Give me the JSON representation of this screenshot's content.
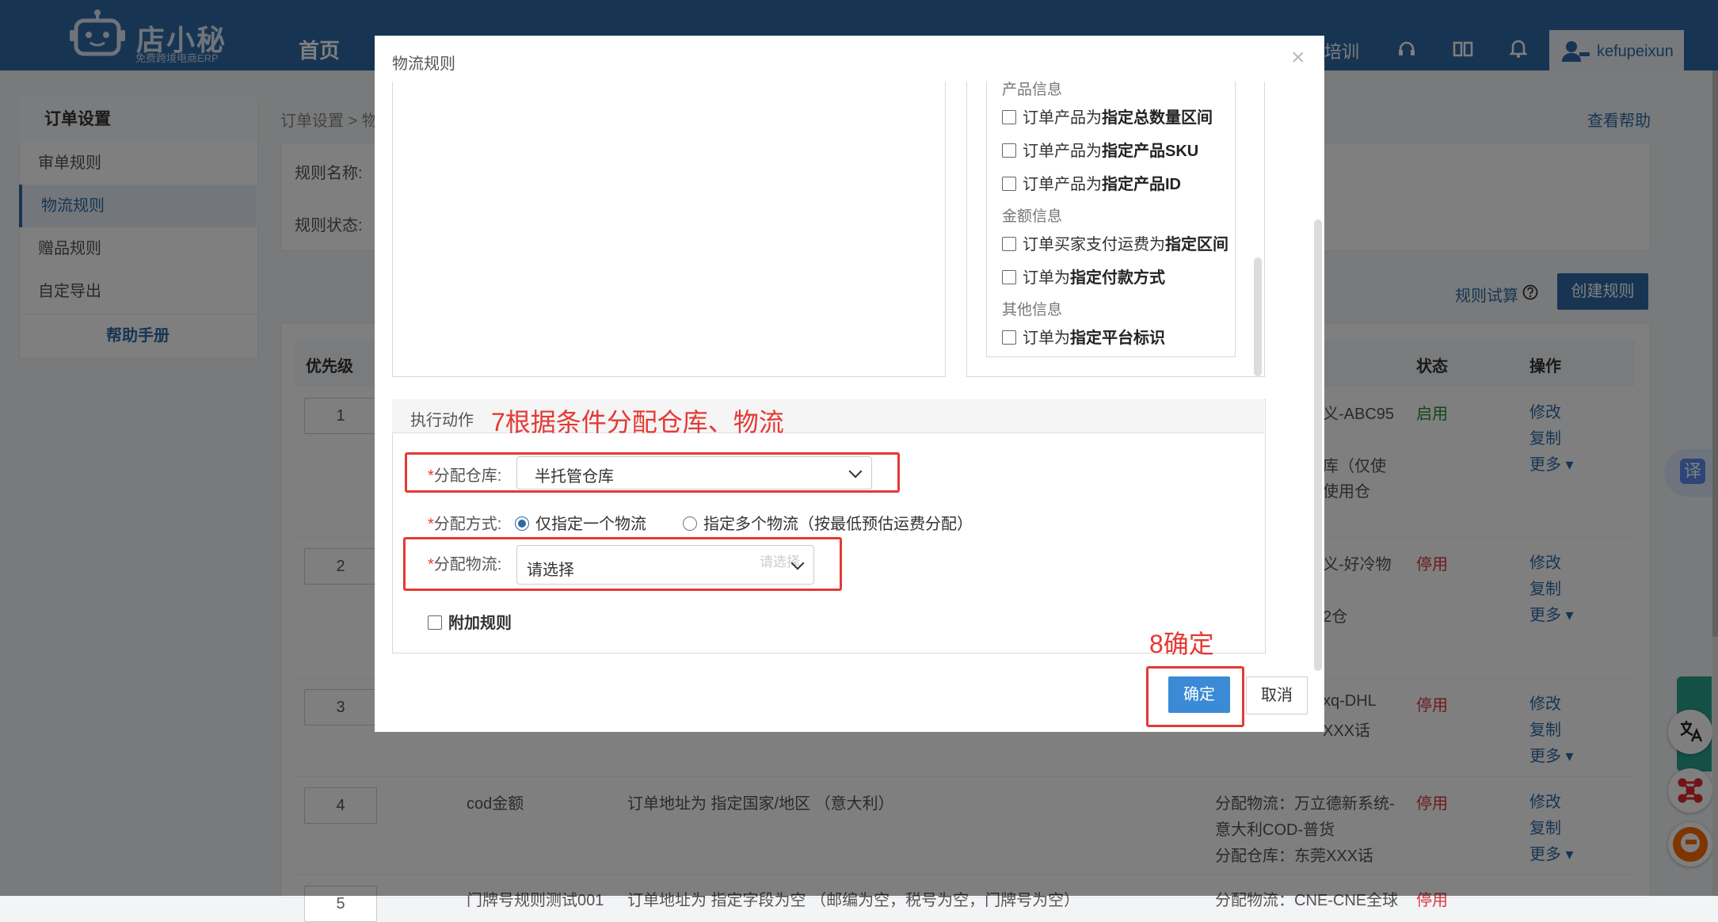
{
  "app": {
    "logo_title": "店小秘",
    "logo_subtitle": "免费跨境电商ERP",
    "nav": [
      "首页"
    ],
    "nav_right": "培训",
    "username": "kefupeixun"
  },
  "sidebar": {
    "header": "订单设置",
    "items": [
      {
        "label": "审单规则"
      },
      {
        "label": "物流规则"
      },
      {
        "label": "赠品规则"
      },
      {
        "label": "自定导出"
      }
    ],
    "help": "帮助手册"
  },
  "main": {
    "breadcrumb": "订单设置 > 物",
    "help_link": "查看帮助",
    "filter": {
      "rule_name_label": "规则名称:",
      "rule_status_label": "规则状态:"
    },
    "trial_link": "规则试算",
    "create_button": "创建规则",
    "table": {
      "headers": {
        "priority": "优先级",
        "status": "状态",
        "ops": "操作"
      },
      "rows": [
        {
          "priority": "1",
          "action_lines": [
            "义-ABC95",
            "库（仅使",
            "使用仓"
          ],
          "status": "启用",
          "status_on": true
        },
        {
          "priority": "2",
          "action_lines": [
            "义-好冷物",
            "",
            "2仓"
          ],
          "status": "停用",
          "status_on": false
        },
        {
          "priority": "3",
          "action_lines": [
            "xq-DHL",
            "XXX话"
          ],
          "status": "停用",
          "status_on": false
        },
        {
          "priority": "4",
          "name": "cod金额",
          "condition": "订单地址为 指定国家/地区 （意大利）",
          "action_lines": [
            "分配物流：万立德新系统-",
            "意大利COD-普货",
            "分配仓库：东莞XXX话"
          ],
          "status": "停用",
          "status_on": false
        },
        {
          "priority": "5",
          "name": "门牌号规则测试001",
          "condition": "订单地址为 指定字段为空 （邮编为空，税号为空，门牌号为空）",
          "action_lines": [
            "分配物流：CNE-CNE全球"
          ],
          "status": "停用",
          "status_on": false
        }
      ],
      "op_labels": {
        "edit": "修改",
        "copy": "复制",
        "more": "更多"
      }
    },
    "float_translate": "译"
  },
  "modal": {
    "title": "物流规则",
    "close": "×",
    "conditions": {
      "group_product": "产品信息",
      "product_items": [
        {
          "prefix": "订单产品为",
          "bold": "指定总数量区间"
        },
        {
          "prefix": "订单产品为",
          "bold": "指定产品SKU"
        },
        {
          "prefix": "订单产品为",
          "bold": "指定产品ID"
        }
      ],
      "group_amount": "金额信息",
      "amount_items": [
        {
          "prefix": "订单买家支付运费为",
          "bold": "指定区间"
        },
        {
          "prefix": "订单为",
          "bold": "指定付款方式"
        }
      ],
      "group_other": "其他信息",
      "other_items": [
        {
          "prefix": "订单为",
          "bold": "指定平台标识"
        }
      ]
    },
    "action": {
      "title": "执行动作",
      "annotation": "7根据条件分配仓库、物流",
      "warehouse_label": "分配仓库:",
      "warehouse_value": "半托管仓库",
      "method_label": "分配方式:",
      "method_options": [
        "仅指定一个物流",
        "指定多个物流（按最低预估运费分配）"
      ],
      "logistics_label": "分配物流:",
      "logistics_value": "请选择",
      "logistics_ghost": "请选择",
      "extra_rule": "附加规则",
      "required_mark": "*"
    },
    "annotation_confirm": "8确定",
    "ok": "确定",
    "cancel": "取消"
  },
  "colors": {
    "brand": "#2e6aa6",
    "annotation": "#e53935",
    "status_on": "#2c8a3a",
    "status_off": "#d9363e"
  }
}
